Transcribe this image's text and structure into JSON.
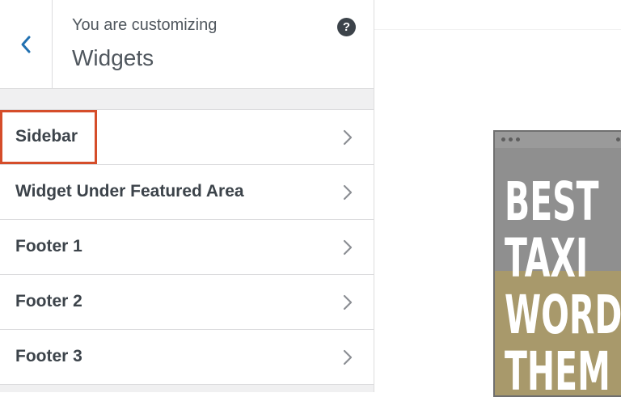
{
  "header": {
    "customizing_label": "You are customizing",
    "title": "Widgets",
    "back_icon": "chevron-left-icon",
    "help_icon": "question-mark-icon",
    "help_glyph": "?"
  },
  "sections": [
    {
      "label": "Sidebar",
      "highlighted": true
    },
    {
      "label": "Widget Under Featured Area"
    },
    {
      "label": "Footer 1"
    },
    {
      "label": "Footer 2"
    },
    {
      "label": "Footer 3"
    }
  ],
  "preview": {
    "thumbnail_lines": [
      "BEST",
      "TAXI",
      "WORD",
      "THEM"
    ]
  },
  "colors": {
    "highlight": "#d54d2a",
    "back_chevron": "#2271b1",
    "thumbnail_gold": "#a8996b"
  }
}
